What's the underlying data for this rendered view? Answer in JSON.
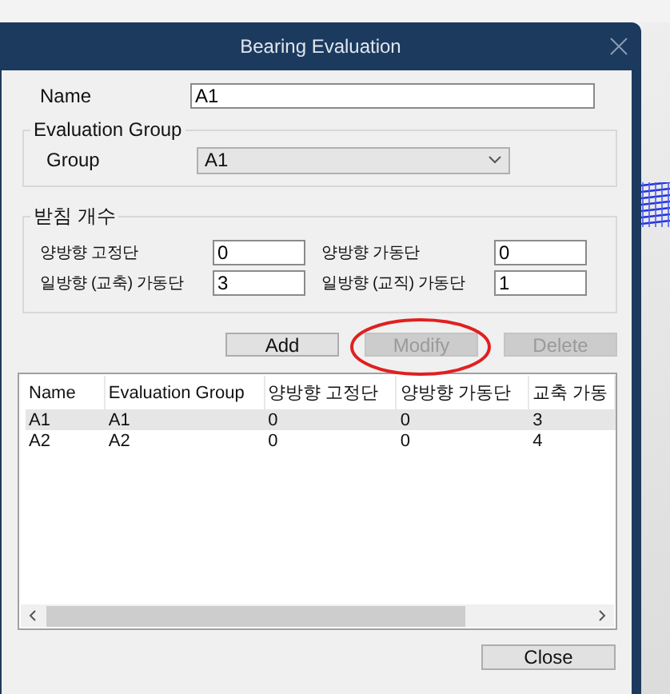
{
  "window": {
    "title": "Bearing Evaluation"
  },
  "name_field": {
    "label": "Name",
    "value": "A1"
  },
  "evaluation_group": {
    "legend": "Evaluation Group",
    "label": "Group",
    "value": "A1"
  },
  "bearing_count": {
    "legend": "받침 개수",
    "fields": [
      {
        "label": "양방향 고정단",
        "value": "0"
      },
      {
        "label": "양방향 가동단",
        "value": "0"
      },
      {
        "label": "일방향 (교축) 가동단",
        "value": "3"
      },
      {
        "label": "일방향 (교직) 가동단",
        "value": "1"
      }
    ]
  },
  "actions": [
    {
      "label": "Add",
      "disabled": false
    },
    {
      "label": "Modify",
      "disabled": true
    },
    {
      "label": "Delete",
      "disabled": true
    }
  ],
  "table": {
    "columns": [
      "Name",
      "Evaluation Group",
      "양방향 고정단",
      "양방향 가동단",
      "교축 가동"
    ],
    "rows": [
      {
        "cells": [
          "A1",
          "A1",
          "0",
          "0",
          "3"
        ],
        "selected": true
      },
      {
        "cells": [
          "A2",
          "A2",
          "0",
          "0",
          "4"
        ],
        "selected": false
      }
    ]
  },
  "close_button": {
    "label": "Close"
  }
}
